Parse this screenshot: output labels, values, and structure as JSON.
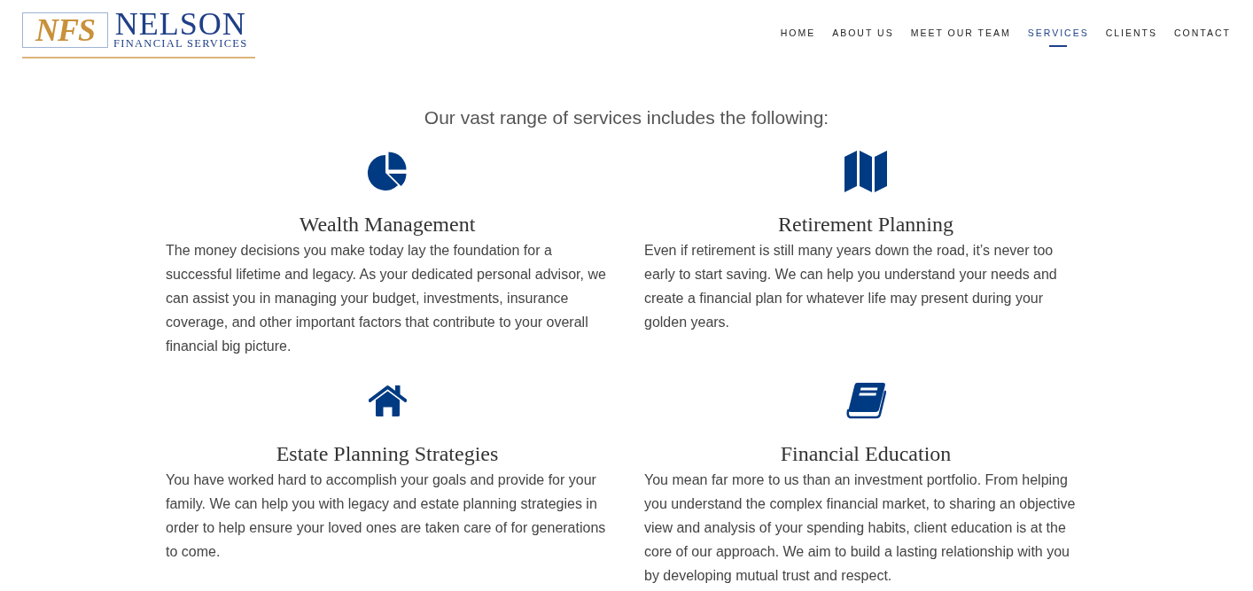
{
  "logo": {
    "monogram": "NFS",
    "name": "NELSON",
    "tagline": "FINANCIAL SERVICES"
  },
  "nav": [
    {
      "label": "HOME",
      "selected": false
    },
    {
      "label": "ABOUT US",
      "selected": false
    },
    {
      "label": "MEET OUR TEAM",
      "selected": false
    },
    {
      "label": "SERVICES",
      "selected": true
    },
    {
      "label": "CLIENTS",
      "selected": false
    },
    {
      "label": "CONTACT",
      "selected": false
    }
  ],
  "heading": "Our vast range of services includes the following:",
  "services": [
    {
      "title": "Wealth Management",
      "description": "The money decisions you make today lay the foundation for a successful lifetime and legacy. As your dedicated personal advisor, we can assist you in managing your budget, investments, insurance coverage, and other important factors that contribute to your overall financial big picture."
    },
    {
      "title": "Retirement Planning",
      "description": "Even if retirement is still many years down the road, it’s never too early to start saving. We can help you understand your needs and create a financial plan for whatever life may present during your golden years."
    },
    {
      "title": "Estate Planning Strategies",
      "description": "You have worked hard to accomplish your goals and provide for your family. We can help you with legacy and estate planning strategies in order to help ensure your loved ones are taken care of for generations to come."
    },
    {
      "title": "Financial Education",
      "description": "You mean far more to us than an investment portfolio. From helping you understand the complex financial market, to sharing an objective view and analysis of your spending habits, client education is at the core of our approach. We aim to build a lasting relationship with you by developing mutual trust and respect."
    }
  ]
}
